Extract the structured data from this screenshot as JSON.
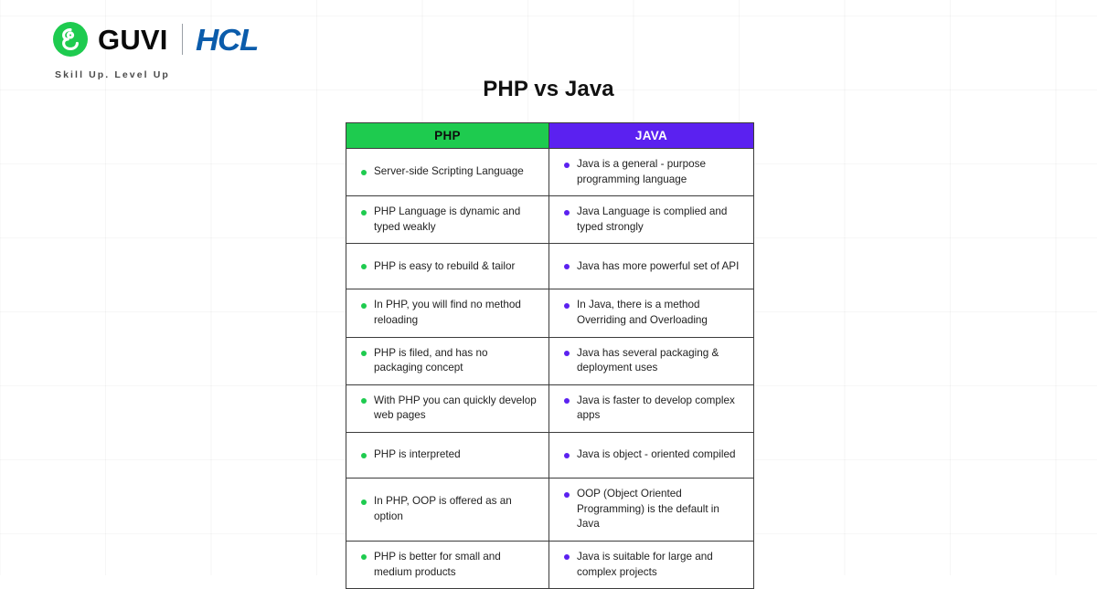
{
  "brand": {
    "logo_icon": "guvi-circle-g-icon",
    "name": "GUVI",
    "partner": "HCL",
    "tagline": "Skill Up. Level Up",
    "guvi_green": "#1ECB4F",
    "hcl_blue": "#0B5CAB"
  },
  "title": "PHP vs Java",
  "table": {
    "headers": {
      "php": "PHP",
      "java": "JAVA"
    },
    "colors": {
      "php_header_bg": "#1ECB4F",
      "php_header_text": "#0D0D0D",
      "java_header_bg": "#5B21F0",
      "java_header_text": "#FFFFFF",
      "php_bullet": "#1ECB4F",
      "java_bullet": "#5B21F0",
      "border": "#3C3C3C"
    },
    "rows": [
      {
        "php": "Server-side Scripting Language",
        "java": "Java is a general - purpose programming language"
      },
      {
        "php": "PHP Language is dynamic and typed weakly",
        "java": "Java Language is complied and typed strongly"
      },
      {
        "php": "PHP is easy to rebuild & tailor",
        "java": "Java has more powerful set of API"
      },
      {
        "php": "In PHP, you will find no method reloading",
        "java": "In Java, there is a method Overriding and Overloading"
      },
      {
        "php": "PHP is filed, and has no packaging concept",
        "java": "Java has several packaging & deployment uses"
      },
      {
        "php": "With PHP you can quickly develop web pages",
        "java": "Java is faster to develop  complex apps"
      },
      {
        "php": "PHP is interpreted",
        "java": "Java is object - oriented compiled"
      },
      {
        "php": "In PHP, OOP is offered as an option",
        "java": "OOP (Object Oriented Programming) is the default in Java"
      },
      {
        "php": "PHP is better for small and medium products",
        "java": "Java is suitable for large and complex projects"
      }
    ]
  }
}
